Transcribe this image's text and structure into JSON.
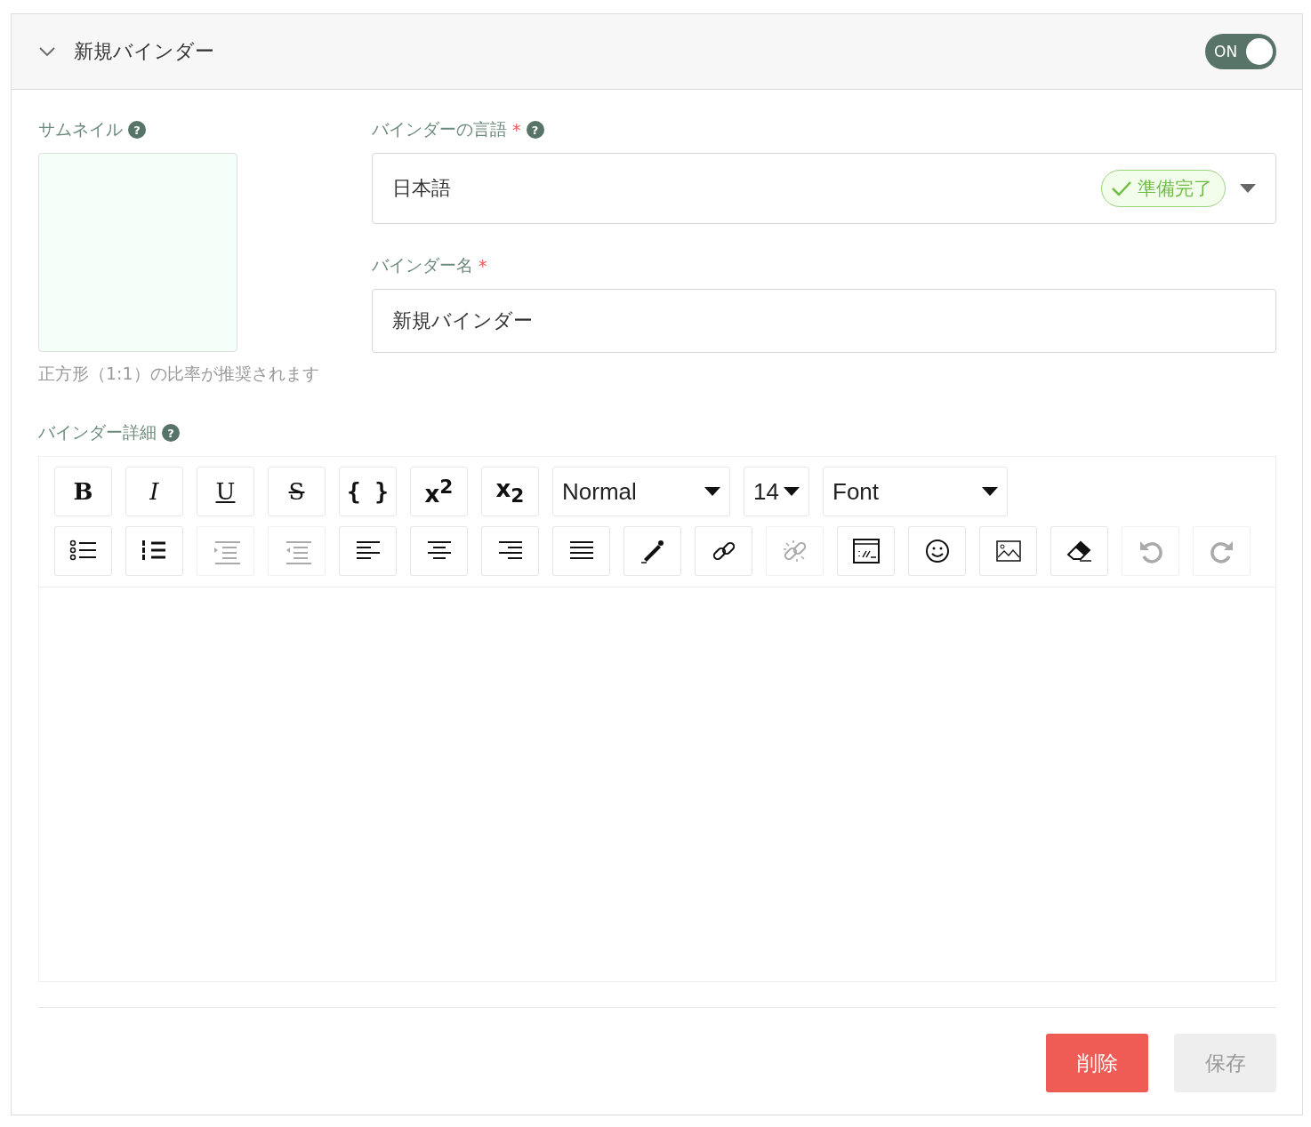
{
  "header": {
    "title": "新規バインダー",
    "expanded": true,
    "toggle": {
      "label": "ON",
      "on": true
    }
  },
  "thumbnail": {
    "label": "サムネイル",
    "help": "?",
    "hint": "正方形（1:1）の比率が推奨されます"
  },
  "language": {
    "label": "バインダーの言語",
    "required": "*",
    "help": "?",
    "value": "日本語",
    "status": "準備完了"
  },
  "name": {
    "label": "バインダー名",
    "required": "*",
    "value": "新規バインダー"
  },
  "details": {
    "label": "バインダー詳細",
    "help": "?",
    "toolbar": [
      [
        {
          "kind": "bold",
          "label": "B"
        },
        {
          "kind": "italic",
          "label": "I"
        },
        {
          "kind": "underline",
          "label": "U"
        },
        {
          "kind": "strike",
          "label": "S"
        },
        {
          "kind": "code",
          "label": "{ }"
        },
        {
          "kind": "script",
          "label": "x$^{2}$"
        },
        {
          "kind": "script",
          "label": "x$_{2}$"
        },
        {
          "kind": "select",
          "label": "Normal"
        },
        {
          "kind": "select",
          "label": "14"
        },
        {
          "kind": "select",
          "label": "Font"
        }
      ],
      [
        {
          "kind": "bullets",
          "disabled": false
        },
        {
          "kind": "numbers",
          "disabled": false
        },
        {
          "kind": "indent",
          "disabled": true
        },
        {
          "kind": "outdent",
          "disabled": true
        },
        {
          "kind": "align-left",
          "disabled": false
        },
        {
          "kind": "align-center",
          "disabled": false
        },
        {
          "kind": "align-right",
          "disabled": false
        },
        {
          "kind": "justify",
          "disabled": false
        },
        {
          "kind": "pen",
          "disabled": false
        },
        {
          "kind": "link",
          "disabled": false
        },
        {
          "kind": "unlink",
          "disabled": true
        },
        {
          "kind": "code-block",
          "disabled": false
        },
        {
          "kind": "emoji",
          "disabled": false
        },
        {
          "kind": "image",
          "disabled": false
        },
        {
          "kind": "eraser",
          "disabled": false
        },
        {
          "kind": "undo",
          "disabled": true
        },
        {
          "kind": "redo",
          "disabled": true
        }
      ]
    ]
  },
  "actions": [
    {
      "label": "削除",
      "kind": "danger",
      "disabled": false
    },
    {
      "label": "保存",
      "kind": "primary",
      "disabled": true
    }
  ]
}
